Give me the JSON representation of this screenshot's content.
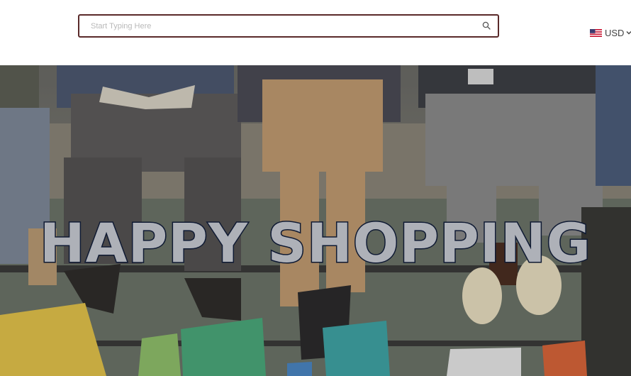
{
  "search": {
    "placeholder": "Start Typing Here",
    "value": ""
  },
  "currency": {
    "code": "USD",
    "flag": "us-flag-icon"
  },
  "hero": {
    "headline": "HAPPY SHOPPING"
  },
  "colors": {
    "search_border": "#5a2a2a",
    "headline_fill": "#aeb1b8",
    "headline_outline": "#0f1a33"
  }
}
